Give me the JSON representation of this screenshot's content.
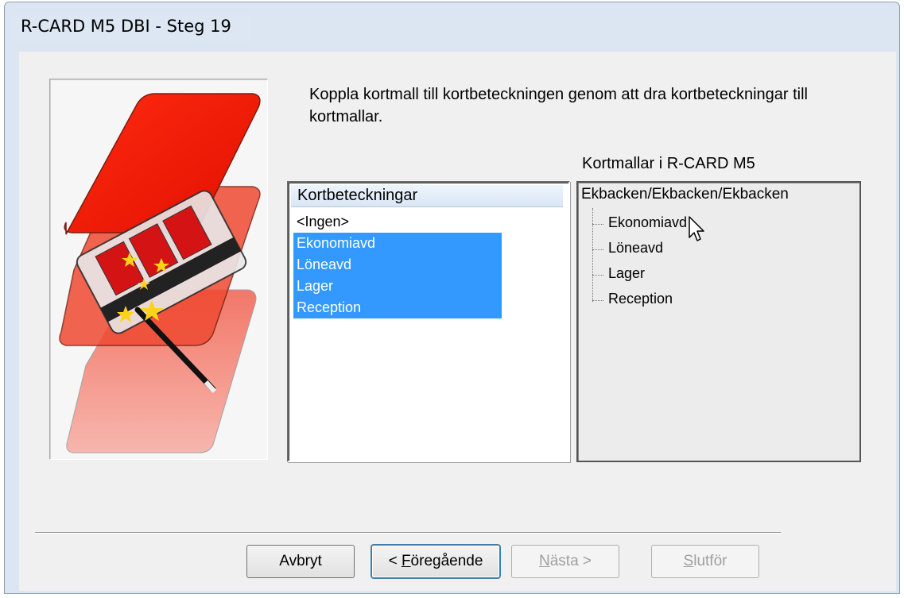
{
  "window": {
    "title": "R-CARD M5 DBI - Steg 19"
  },
  "instruction": "Koppla kortmall till kortbeteckningen genom att dra kortbeteckningar till kortmallar.",
  "left_list": {
    "header": "Kortbeteckningar",
    "items": [
      {
        "label": "<Ingen>",
        "selected": false
      },
      {
        "label": "Ekonomiavd",
        "selected": true
      },
      {
        "label": "Löneavd",
        "selected": true
      },
      {
        "label": "Lager",
        "selected": true
      },
      {
        "label": "Reception",
        "selected": true
      }
    ],
    "selection_color": "#3399ff"
  },
  "right_tree": {
    "label": "Kortmallar i R-CARD M5",
    "root": "Ekbacken/Ekbacken/Ekbacken",
    "children": [
      "Ekonomiavd",
      "Löneavd",
      "Lager",
      "Reception"
    ]
  },
  "buttons": {
    "cancel": {
      "label": "Avbryt",
      "enabled": true
    },
    "previous": {
      "prefix": "< ",
      "accel": "F",
      "rest": "öregående",
      "enabled": true
    },
    "next": {
      "accel": "N",
      "rest": "ästa >",
      "enabled": false
    },
    "finish": {
      "accel": "S",
      "rest": "lutför",
      "enabled": false
    }
  },
  "icons": {
    "illustration": "card-wizard-illustration",
    "cursor": "mouse-pointer-icon"
  }
}
